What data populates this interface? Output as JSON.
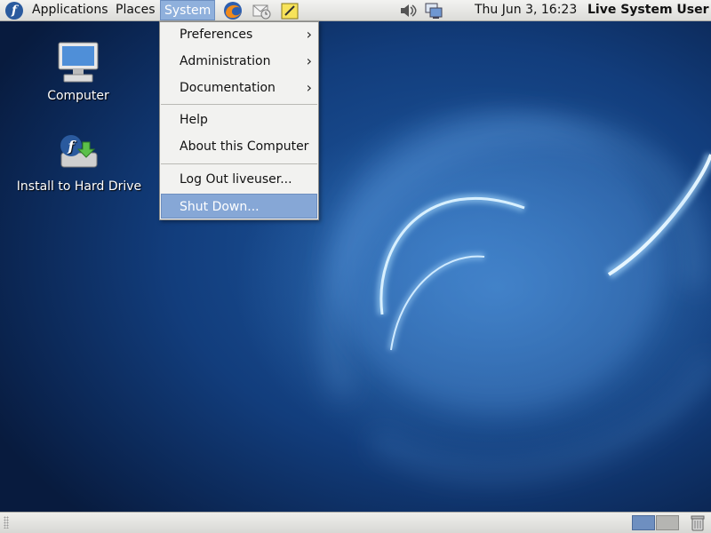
{
  "top_panel": {
    "menus": [
      "Applications",
      "Places",
      "System"
    ],
    "launchers": [
      "firefox-icon",
      "mail-client-icon",
      "notes-icon"
    ],
    "tray": [
      "volume-icon",
      "network-icon"
    ],
    "clock": "Thu Jun  3, 16:23",
    "user": "Live System User"
  },
  "desktop": {
    "icons": [
      {
        "label": "Computer",
        "icon": "computer-icon"
      },
      {
        "label": "Install to Hard Drive",
        "icon": "install-drive-icon"
      }
    ]
  },
  "system_menu": {
    "items": [
      {
        "label": "Preferences",
        "submenu": true
      },
      {
        "label": "Administration",
        "submenu": true
      },
      {
        "label": "Documentation",
        "submenu": true
      },
      {
        "label": "Help",
        "submenu": false
      },
      {
        "label": "About this Computer",
        "submenu": false
      },
      {
        "label": "Log Out liveuser...",
        "submenu": false
      },
      {
        "label": "Shut Down...",
        "submenu": false,
        "highlighted": true
      }
    ],
    "arrow_glyph": "›"
  },
  "bottom_panel": {
    "workspaces": 2,
    "active_workspace": 1
  },
  "colors": {
    "highlight": "#86a7d6",
    "panel": "#e6e6e3",
    "desktop": "#123d7c"
  }
}
